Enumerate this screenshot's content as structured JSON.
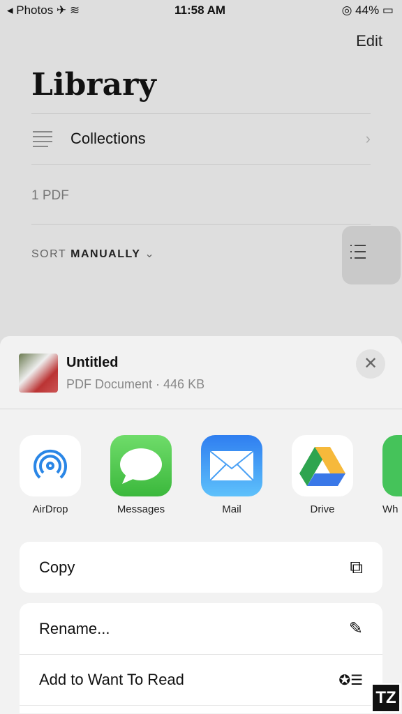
{
  "status": {
    "back_app": "Photos",
    "time": "11:58 AM",
    "battery": "44%"
  },
  "nav": {
    "edit": "Edit",
    "title": "Library"
  },
  "library": {
    "collections": "Collections",
    "pdf_count": "1 PDF",
    "sort_label": "SORT",
    "sort_value": "MANUALLY"
  },
  "sheet": {
    "file_name": "Untitled",
    "file_meta": "PDF Document · 446 KB",
    "apps": [
      {
        "label": "AirDrop"
      },
      {
        "label": "Messages"
      },
      {
        "label": "Mail"
      },
      {
        "label": "Drive"
      },
      {
        "label": "Wh"
      }
    ],
    "actions": {
      "copy": "Copy",
      "rename": "Rename...",
      "want_to_read": "Add to Want To Read"
    }
  },
  "watermark": "TZ"
}
